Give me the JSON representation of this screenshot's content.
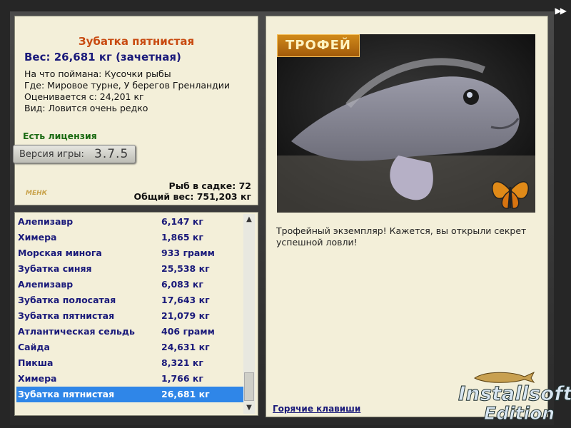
{
  "controls": {
    "skip_label": "▶▶"
  },
  "catch_info": {
    "fish_name": "Зубатка пятнистая",
    "weight_line": "Вес: 26,681 кг (зачетная)",
    "bait_line": "На что поймана: Кусочки рыбы",
    "location_line": "Где: Мировое турне, У берегов Гренландии",
    "valued_from_line": "Оценивается с: 24,201 кг",
    "rarity_line": "Вид: Ловится очень редко",
    "license_label": "Есть лицензия",
    "version_label": "Версия игры:",
    "version_value": "3.7.5",
    "keepnet_count_line": "Рыб в садке: 72",
    "total_weight_line": "Общий вес: 751,203 кг",
    "logo_text": "МЕНК"
  },
  "catch_list": {
    "rows": [
      {
        "name": "Алепизавр",
        "weight": "6,147 кг"
      },
      {
        "name": "Химера",
        "weight": "1,865 кг"
      },
      {
        "name": "Морская минога",
        "weight": "933 грамм"
      },
      {
        "name": "Зубатка синяя",
        "weight": "25,538 кг"
      },
      {
        "name": "Алепизавр",
        "weight": "6,083 кг"
      },
      {
        "name": "Зубатка полосатая",
        "weight": "17,643 кг"
      },
      {
        "name": "Зубатка пятнистая",
        "weight": "21,079 кг"
      },
      {
        "name": "Атлантическая сельдь",
        "weight": "406 грамм"
      },
      {
        "name": "Сайда",
        "weight": "24,631 кг"
      },
      {
        "name": "Пикша",
        "weight": "8,321 кг"
      },
      {
        "name": "Химера",
        "weight": "1,766 кг"
      },
      {
        "name": "Зубатка пятнистая",
        "weight": "26,681 кг"
      }
    ],
    "selected_index": 11
  },
  "trophy": {
    "badge_label": "ТРОФЕЙ",
    "description": "Трофейный экземпляр! Кажется, вы открыли секрет успешной ловли!",
    "hotkeys_link": "Горячие клавиши"
  },
  "watermark": {
    "line1": "Installsoft",
    "line2": "Edition"
  },
  "colors": {
    "selected_row": "#2f86e8",
    "title": "#c84a10",
    "license": "#1a6a12",
    "link": "#1a1a7a"
  }
}
